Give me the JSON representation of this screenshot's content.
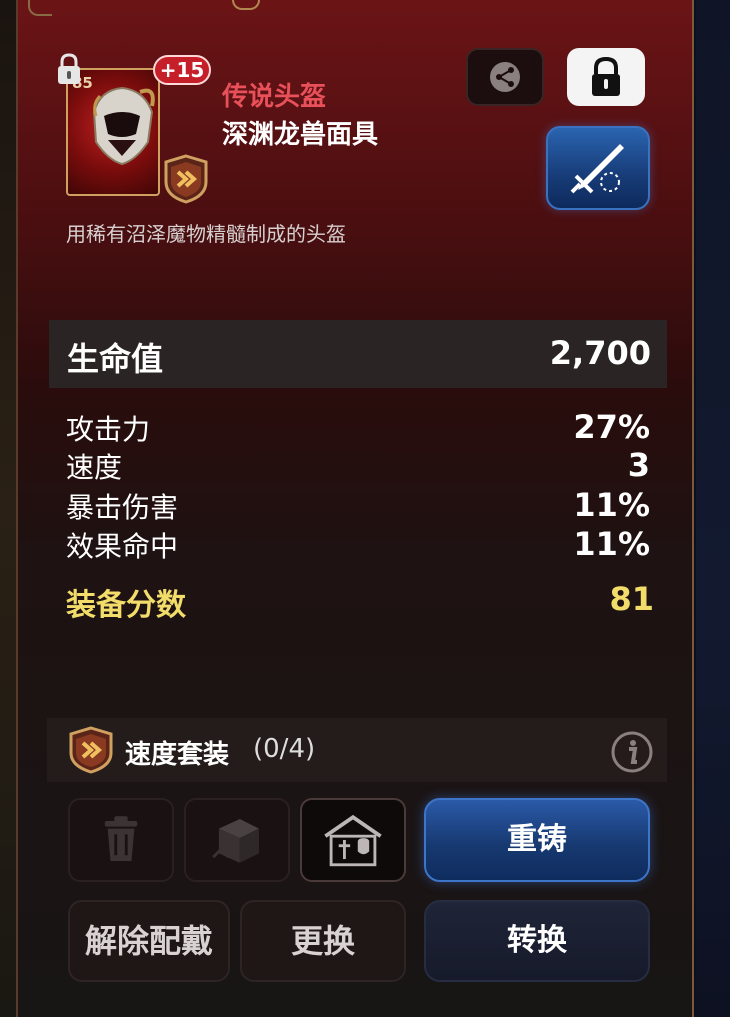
{
  "item": {
    "level": "85",
    "enhance": "+15",
    "rarity": "传说头盔",
    "name": "深渊龙兽面具",
    "description": "用稀有沼泽魔物精髓制成的头盔"
  },
  "main_stat": {
    "label": "生命值",
    "value": "2,700"
  },
  "sub_stats": [
    {
      "label": "攻击力",
      "value": "27%"
    },
    {
      "label": "速度",
      "value": "3"
    },
    {
      "label": "暴击伤害",
      "value": "11%"
    },
    {
      "label": "效果命中",
      "value": "11%"
    }
  ],
  "score": {
    "label": "装备分数",
    "value": "81"
  },
  "set": {
    "label": "速度套装",
    "count": "(0/4)"
  },
  "buttons": {
    "reforge": "重铸",
    "unequip": "解除配戴",
    "change": "更换",
    "convert": "转换"
  },
  "icons": {
    "lock_small": "padlock-icon",
    "share": "share-icon",
    "lock": "lock-icon",
    "skill": "sword-skill-icon",
    "set": "speed-set-icon",
    "info": "info-icon",
    "delete": "trash-icon",
    "extract": "dice-icon",
    "storage": "shop-icon"
  },
  "colors": {
    "rarity": "#e8505a",
    "score": "#f2dc6a",
    "enhance_badge": "#c51f2a",
    "reforge": "#2b5aa8"
  }
}
